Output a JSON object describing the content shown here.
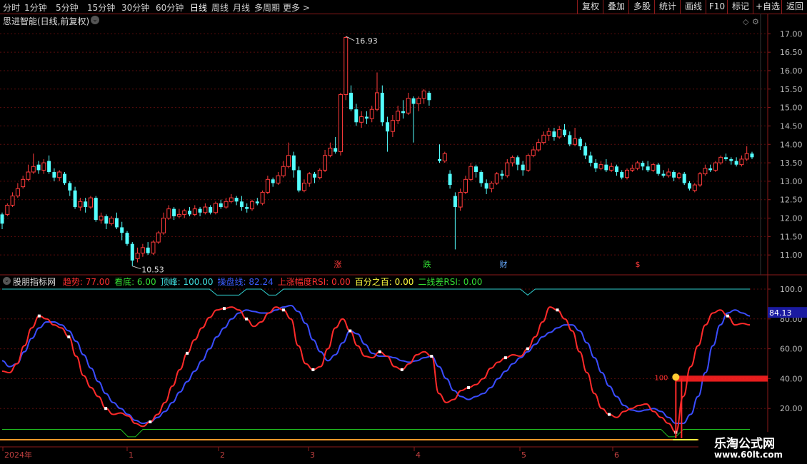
{
  "toolbar": {
    "left_tabs": [
      "分时",
      "1分钟",
      "5分钟",
      "15分钟",
      "30分钟",
      "60分钟",
      "日线",
      "周线",
      "月线",
      "多周期",
      "更多 >"
    ],
    "active_tab": "日线",
    "right_buttons": [
      "复权",
      "叠加",
      "多股",
      "统计",
      "画线",
      "F10",
      "标记",
      "+自选",
      "返回"
    ]
  },
  "main_panel": {
    "title": "思进智能(日线,前复权)",
    "high_label": "16.93",
    "low_label": "10.53",
    "price_ticks": [
      "17.00",
      "16.50",
      "16.00",
      "15.50",
      "15.00",
      "14.50",
      "14.00",
      "13.50",
      "13.00",
      "12.50",
      "12.00",
      "11.50",
      "11.00"
    ],
    "event_markers": [
      {
        "label": "涨",
        "color": "#ff3b3b"
      },
      {
        "label": "跌",
        "color": "#33dd33"
      },
      {
        "label": "财",
        "color": "#66aaff"
      },
      {
        "label": "$",
        "color": "#ff3b3b"
      }
    ]
  },
  "indicator_panel": {
    "name": "股朋指标网",
    "legend": [
      {
        "label": "趋势: 77.00",
        "color": "#ff3030"
      },
      {
        "label": "看底: 6.00",
        "color": "#33dd33"
      },
      {
        "label": "顶峰: 100.00",
        "color": "#3fe0e0"
      },
      {
        "label": "操盘线: 82.24",
        "color": "#3a5cff"
      },
      {
        "label": "上涨幅度RSI: 0.00",
        "color": "#ff3030"
      },
      {
        "label": "百分之百: 0.00",
        "color": "#ffff40"
      },
      {
        "label": "二线差RSI: 0.00",
        "color": "#33dd33"
      }
    ],
    "axis_ticks": [
      "100.0",
      "80.00",
      "60.00",
      "40.00",
      "20.00"
    ],
    "current_value_badge": "84.13",
    "signal_label": "100"
  },
  "time_axis": {
    "labels": [
      "2024年",
      "1",
      "2",
      "3",
      "4",
      "5",
      "6"
    ]
  },
  "watermark": {
    "line1": "乐淘公式网",
    "line2": "www.60lt.com"
  },
  "chart_data": {
    "type": "candlestick",
    "ylim": [
      10.5,
      17.2
    ],
    "candles": [
      [
        12.1,
        11.85,
        12.15,
        11.7
      ],
      [
        12.1,
        12.35,
        12.4,
        12.05
      ],
      [
        12.35,
        12.6,
        12.7,
        12.3
      ],
      [
        12.6,
        12.8,
        12.95,
        12.55
      ],
      [
        12.85,
        13.05,
        13.15,
        12.8
      ],
      [
        13.05,
        13.25,
        13.45,
        13.0
      ],
      [
        13.25,
        13.4,
        13.75,
        13.2
      ],
      [
        13.45,
        13.3,
        13.55,
        13.2
      ],
      [
        13.3,
        13.5,
        13.6,
        13.2
      ],
      [
        13.55,
        13.25,
        13.7,
        13.2
      ],
      [
        13.25,
        13.1,
        13.35,
        13.0
      ],
      [
        13.1,
        13.25,
        13.3,
        13.0
      ],
      [
        13.2,
        12.95,
        13.25,
        12.9
      ],
      [
        12.95,
        12.75,
        13.0,
        12.6
      ],
      [
        12.75,
        12.3,
        12.85,
        12.25
      ],
      [
        12.3,
        12.45,
        12.55,
        12.2
      ],
      [
        12.45,
        12.3,
        12.55,
        12.15
      ],
      [
        12.3,
        12.55,
        12.6,
        12.25
      ],
      [
        12.55,
        11.95,
        12.6,
        11.9
      ],
      [
        11.95,
        12.05,
        12.15,
        11.85
      ],
      [
        12.05,
        11.85,
        12.1,
        11.7
      ],
      [
        11.85,
        12.0,
        12.05,
        11.8
      ],
      [
        12.0,
        11.75,
        12.15,
        11.7
      ],
      [
        11.75,
        11.6,
        11.9,
        11.4
      ],
      [
        11.6,
        11.3,
        11.65,
        11.25
      ],
      [
        11.3,
        10.85,
        11.35,
        10.7
      ],
      [
        10.9,
        11.05,
        11.2,
        10.8
      ],
      [
        11.05,
        11.2,
        11.3,
        10.95
      ],
      [
        11.2,
        11.05,
        11.35,
        11.0
      ],
      [
        11.05,
        11.35,
        11.4,
        11.0
      ],
      [
        11.35,
        11.6,
        11.65,
        11.3
      ],
      [
        11.6,
        12.0,
        12.15,
        11.55
      ],
      [
        12.0,
        12.25,
        12.35,
        11.95
      ],
      [
        12.25,
        12.05,
        12.3,
        11.95
      ],
      [
        12.05,
        12.1,
        12.25,
        12.0
      ],
      [
        12.1,
        12.2,
        12.25,
        12.0
      ],
      [
        12.2,
        12.1,
        12.3,
        12.05
      ],
      [
        12.1,
        12.25,
        12.35,
        12.05
      ],
      [
        12.25,
        12.15,
        12.3,
        12.05
      ],
      [
        12.15,
        12.3,
        12.4,
        12.1
      ],
      [
        12.3,
        12.15,
        12.35,
        12.1
      ],
      [
        12.15,
        12.4,
        12.45,
        12.1
      ],
      [
        12.4,
        12.3,
        12.5,
        12.25
      ],
      [
        12.3,
        12.45,
        12.55,
        12.25
      ],
      [
        12.45,
        12.55,
        12.65,
        12.4
      ],
      [
        12.55,
        12.45,
        12.6,
        12.35
      ],
      [
        12.45,
        12.3,
        12.6,
        12.2
      ],
      [
        12.3,
        12.25,
        12.4,
        12.15
      ],
      [
        12.25,
        12.45,
        12.5,
        12.2
      ],
      [
        12.45,
        12.4,
        12.55,
        12.35
      ],
      [
        12.4,
        12.7,
        12.75,
        12.35
      ],
      [
        12.7,
        13.05,
        13.15,
        12.65
      ],
      [
        13.05,
        12.95,
        13.1,
        12.85
      ],
      [
        12.95,
        13.15,
        13.25,
        12.9
      ],
      [
        13.15,
        13.4,
        13.55,
        13.1
      ],
      [
        13.4,
        13.7,
        14.05,
        13.35
      ],
      [
        13.7,
        13.3,
        13.8,
        13.1
      ],
      [
        13.3,
        12.75,
        13.4,
        12.7
      ],
      [
        12.75,
        12.95,
        13.05,
        12.7
      ],
      [
        12.95,
        13.2,
        13.25,
        12.85
      ],
      [
        13.2,
        13.1,
        13.25,
        12.95
      ],
      [
        13.1,
        13.3,
        13.35,
        13.05
      ],
      [
        13.3,
        13.7,
        13.85,
        13.25
      ],
      [
        13.7,
        13.9,
        14.05,
        13.65
      ],
      [
        13.9,
        13.8,
        14.2,
        13.75
      ],
      [
        13.8,
        15.35,
        15.4,
        13.7
      ],
      [
        15.35,
        16.9,
        16.93,
        15.2
      ],
      [
        15.4,
        14.95,
        15.6,
        14.9
      ],
      [
        14.95,
        14.6,
        15.1,
        14.5
      ],
      [
        14.6,
        14.75,
        14.9,
        14.45
      ],
      [
        14.75,
        14.7,
        14.9,
        14.55
      ],
      [
        14.7,
        14.95,
        15.05,
        14.6
      ],
      [
        14.95,
        15.4,
        15.95,
        14.9
      ],
      [
        15.4,
        14.6,
        15.6,
        14.5
      ],
      [
        14.6,
        14.35,
        14.75,
        13.8
      ],
      [
        14.35,
        14.65,
        14.8,
        14.2
      ],
      [
        14.65,
        14.9,
        15.05,
        14.55
      ],
      [
        14.9,
        14.85,
        15.2,
        14.7
      ],
      [
        14.85,
        15.25,
        15.4,
        14.8
      ],
      [
        15.25,
        15.1,
        15.3,
        14.05
      ],
      [
        15.1,
        15.25,
        15.3,
        14.9
      ],
      [
        15.25,
        15.45,
        15.5,
        15.1
      ],
      [
        15.4,
        15.2,
        15.45,
        15.05
      ],
      [
        null,
        null,
        null,
        null
      ],
      [
        13.6,
        13.55,
        14.0,
        13.5
      ],
      [
        13.55,
        13.75,
        13.8,
        13.5
      ],
      [
        13.2,
        12.9,
        13.3,
        12.8
      ],
      [
        12.6,
        12.3,
        12.7,
        11.15
      ],
      [
        12.3,
        12.7,
        12.8,
        12.2
      ],
      [
        12.7,
        13.05,
        13.15,
        12.65
      ],
      [
        13.05,
        13.4,
        13.5,
        13.0
      ],
      [
        13.4,
        13.25,
        13.45,
        13.1
      ],
      [
        13.25,
        12.95,
        13.3,
        12.85
      ],
      [
        12.95,
        12.8,
        13.05,
        12.65
      ],
      [
        12.8,
        12.95,
        13.0,
        12.7
      ],
      [
        12.95,
        13.2,
        13.25,
        12.9
      ],
      [
        13.2,
        13.15,
        13.3,
        13.05
      ],
      [
        13.15,
        13.5,
        13.6,
        13.1
      ],
      [
        13.5,
        13.65,
        13.7,
        13.4
      ],
      [
        13.65,
        13.45,
        13.7,
        13.3
      ],
      [
        13.45,
        13.3,
        13.55,
        13.15
      ],
      [
        13.3,
        13.7,
        13.75,
        13.25
      ],
      [
        13.7,
        13.85,
        13.95,
        13.65
      ],
      [
        13.85,
        14.05,
        14.15,
        13.8
      ],
      [
        14.05,
        14.25,
        14.35,
        14.0
      ],
      [
        14.25,
        14.35,
        14.45,
        14.1
      ],
      [
        14.35,
        14.2,
        14.45,
        14.1
      ],
      [
        14.2,
        14.4,
        14.5,
        14.15
      ],
      [
        14.4,
        14.25,
        14.55,
        14.2
      ],
      [
        14.25,
        14.0,
        14.35,
        13.95
      ],
      [
        14.0,
        14.15,
        14.45,
        13.95
      ],
      [
        14.15,
        13.95,
        14.2,
        13.85
      ],
      [
        13.95,
        13.7,
        14.05,
        13.6
      ],
      [
        13.7,
        13.5,
        13.8,
        13.4
      ],
      [
        13.5,
        13.35,
        13.6,
        13.25
      ],
      [
        13.35,
        13.45,
        13.55,
        13.3
      ],
      [
        13.45,
        13.3,
        13.6,
        13.25
      ],
      [
        13.3,
        13.4,
        13.5,
        13.25
      ],
      [
        13.4,
        13.25,
        13.45,
        13.15
      ],
      [
        13.25,
        13.1,
        13.3,
        13.05
      ],
      [
        13.1,
        13.3,
        13.35,
        13.05
      ],
      [
        13.3,
        13.35,
        13.45,
        13.25
      ],
      [
        13.35,
        13.5,
        13.55,
        13.3
      ],
      [
        13.5,
        13.4,
        13.55,
        13.3
      ],
      [
        13.4,
        13.3,
        13.55,
        13.25
      ],
      [
        13.3,
        13.45,
        13.5,
        13.25
      ],
      [
        13.45,
        13.2,
        13.5,
        13.15
      ],
      [
        13.2,
        13.15,
        13.3,
        13.1
      ],
      [
        13.15,
        13.25,
        13.35,
        13.1
      ],
      [
        13.25,
        13.1,
        13.3,
        13.0
      ],
      [
        13.1,
        13.2,
        13.25,
        13.05
      ],
      [
        13.2,
        12.95,
        13.25,
        12.9
      ],
      [
        12.95,
        12.8,
        13.0,
        12.75
      ],
      [
        12.75,
        12.9,
        12.95,
        12.7
      ],
      [
        12.9,
        13.2,
        13.25,
        12.85
      ],
      [
        13.2,
        13.35,
        13.45,
        13.15
      ],
      [
        13.35,
        13.3,
        13.45,
        13.25
      ],
      [
        13.3,
        13.5,
        13.55,
        13.25
      ],
      [
        13.5,
        13.65,
        13.7,
        13.45
      ],
      [
        13.65,
        13.6,
        13.75,
        13.55
      ],
      [
        13.6,
        13.55,
        13.65,
        13.45
      ],
      [
        13.55,
        13.45,
        13.65,
        13.4
      ],
      [
        13.45,
        13.6,
        13.7,
        13.4
      ],
      [
        13.6,
        13.75,
        13.95,
        13.55
      ],
      [
        13.75,
        13.65,
        13.8,
        13.6
      ]
    ],
    "indicator_series": [
      {
        "name": "趋势",
        "color": "#ff2a2a",
        "values": [
          45,
          44,
          50,
          62,
          74,
          82,
          80,
          76,
          74,
          68,
          55,
          42,
          34,
          28,
          20,
          16,
          17,
          15,
          10,
          8,
          11,
          16,
          24,
          35,
          46,
          57,
          66,
          74,
          81,
          86,
          87,
          88,
          86,
          80,
          75,
          78,
          84,
          88,
          86,
          80,
          62,
          50,
          46,
          48,
          60,
          74,
          80,
          72,
          62,
          55,
          54,
          58,
          55,
          48,
          46,
          50,
          56,
          58,
          55,
          30,
          24,
          26,
          32,
          34,
          36,
          40,
          47,
          51,
          54,
          56,
          55,
          60,
          68,
          78,
          88,
          86,
          80,
          72,
          58,
          44,
          30,
          20,
          16,
          14,
          18,
          20,
          22,
          23,
          18,
          14,
          10,
          4,
          28,
          48,
          62,
          76,
          84,
          86,
          82,
          76,
          77,
          76
        ]
      },
      {
        "name": "操盘线",
        "color": "#3a4cff",
        "values": [
          52,
          48,
          50,
          58,
          67,
          74,
          78,
          78,
          76,
          72,
          65,
          56,
          47,
          38,
          30,
          24,
          20,
          16,
          12,
          10,
          11,
          14,
          18,
          24,
          31,
          38,
          45,
          52,
          60,
          68,
          74,
          80,
          84,
          86,
          85,
          84,
          84,
          86,
          88,
          89,
          85,
          77,
          66,
          58,
          52,
          56,
          64,
          72,
          70,
          63,
          57,
          55,
          55,
          54,
          52,
          51,
          52,
          54,
          55,
          48,
          40,
          32,
          28,
          26,
          28,
          30,
          34,
          40,
          45,
          50,
          54,
          58,
          63,
          68,
          71,
          74,
          76,
          76,
          72,
          64,
          54,
          44,
          35,
          28,
          22,
          19,
          18,
          19,
          20,
          18,
          14,
          10,
          10,
          16,
          28,
          44,
          62,
          76,
          84,
          86,
          84,
          82
        ]
      },
      {
        "name": "看底",
        "color": "#20c020",
        "values": [
          6,
          6,
          6,
          6,
          6,
          6,
          6,
          6,
          6,
          6,
          6,
          6,
          6,
          6,
          6,
          6,
          6,
          6,
          6,
          6,
          6,
          6,
          6,
          6,
          6,
          6,
          6,
          6,
          6,
          6,
          6,
          6,
          6,
          6,
          6,
          6,
          6,
          6,
          6,
          6,
          6,
          6,
          6,
          6,
          6,
          6,
          6,
          6,
          6,
          6,
          6,
          6,
          6,
          6,
          6,
          6,
          6,
          6,
          6,
          6,
          6,
          6,
          6,
          6,
          6,
          6,
          6,
          6,
          6,
          6,
          6,
          6,
          6,
          6,
          6,
          6,
          6,
          6,
          6,
          6,
          6,
          6,
          6,
          6,
          6,
          6,
          6,
          6,
          6,
          6,
          6,
          6,
          6,
          6,
          6,
          6,
          6,
          6,
          6,
          6,
          6,
          6
        ]
      },
      {
        "name": "顶峰",
        "color": "#30d0d0",
        "values": [
          100,
          100,
          100,
          100,
          100,
          100,
          100,
          100,
          100,
          100,
          100,
          100,
          100,
          100,
          100,
          100,
          100,
          100,
          100,
          100,
          100,
          100,
          100,
          100,
          100,
          100,
          100,
          100,
          100,
          100,
          100,
          100,
          100,
          100,
          100,
          100,
          100,
          100,
          100,
          100,
          100,
          100,
          100,
          100,
          100,
          100,
          100,
          100,
          100,
          100,
          100,
          100,
          100,
          100,
          100,
          100,
          100,
          100,
          100,
          100,
          100,
          100,
          100,
          100,
          100,
          100,
          100,
          100,
          100,
          100,
          100,
          100,
          100,
          100,
          100,
          100,
          100,
          100,
          100,
          100,
          100,
          100,
          100,
          100,
          100,
          100,
          100,
          100,
          100,
          100,
          100,
          100,
          100,
          100,
          100,
          100,
          100,
          100,
          100,
          100,
          100,
          100
        ]
      }
    ]
  }
}
